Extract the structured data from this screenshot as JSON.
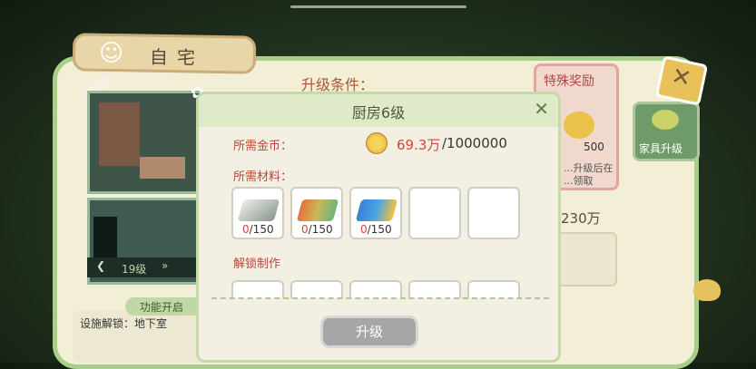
{
  "home": {
    "tab_title": "自宅",
    "floor_label": "19级",
    "upgrade_conditions": "升级条件：",
    "special_reward": {
      "title": "特殊奖励",
      "amount": "500",
      "desc_line1": "...升级后在",
      "desc_line2": "...领取"
    },
    "cost_partial": "230万",
    "furniture_upgrade": "家具升级",
    "function_open": "功能开启",
    "facility_unlock": "设施解锁：地下室"
  },
  "dialog": {
    "title": "厨房6级",
    "coins_label": "所需金币：",
    "coins_have": "69.3万",
    "coins_need": "/1000000",
    "materials_label": "所需材料：",
    "materials": [
      {
        "icon": "silver-ingot-icon",
        "have": "0",
        "need": "/150"
      },
      {
        "icon": "rainbow-ingot-icon",
        "have": "0",
        "need": "/150"
      },
      {
        "icon": "blue-gold-ingot-icon",
        "have": "0",
        "need": "/150"
      }
    ],
    "unlock_label": "解锁制作",
    "upgrade_button": "升级"
  },
  "colors": {
    "panel_border": "#a8cf8a",
    "dialog_header": "#dfeac9",
    "label_red": "#b24a3a",
    "button_disabled": "#a6a6a6"
  }
}
